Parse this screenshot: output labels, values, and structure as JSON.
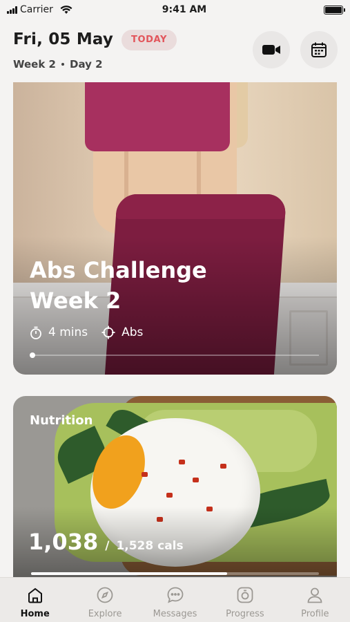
{
  "status_bar": {
    "carrier": "Carrier",
    "time": "9:41 AM"
  },
  "header": {
    "date": "Fri, 05 May",
    "today_badge": "TODAY",
    "week": "Week 2",
    "day": "Day 2"
  },
  "workout_card": {
    "title_line1": "Abs Challenge",
    "title_line2": "Week 2",
    "duration": "4 mins",
    "focus": "Abs",
    "progress": 0.0
  },
  "nutrition_card": {
    "label": "Nutrition",
    "consumed": "1,038",
    "separator": "/",
    "target": "1,528 cals",
    "progress": 0.68
  },
  "tabbar": {
    "items": [
      {
        "label": "Home",
        "icon": "home-icon",
        "active": true
      },
      {
        "label": "Explore",
        "icon": "compass-icon",
        "active": false
      },
      {
        "label": "Messages",
        "icon": "chat-icon",
        "active": false
      },
      {
        "label": "Progress",
        "icon": "progress-icon",
        "active": false
      },
      {
        "label": "Profile",
        "icon": "user-icon",
        "active": false
      }
    ]
  },
  "colors": {
    "accent_badge_text": "#e2555b",
    "badge_bg": "#eadcdc"
  }
}
